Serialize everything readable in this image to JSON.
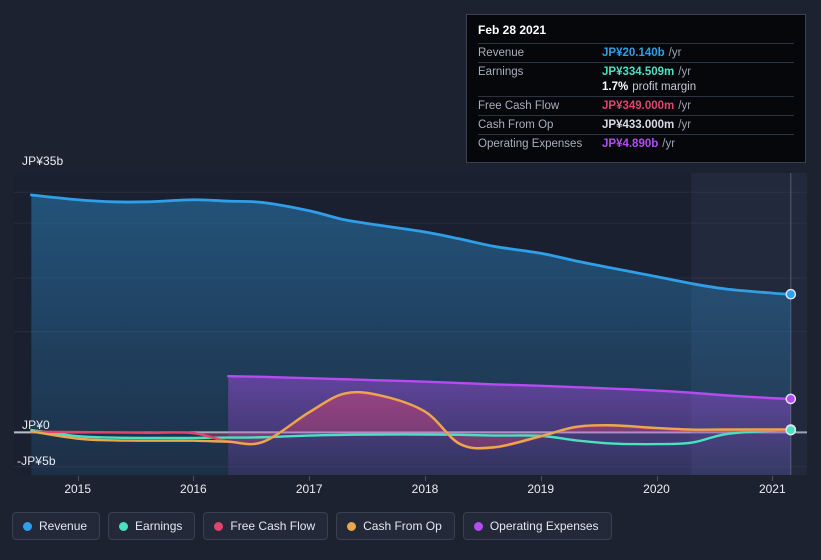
{
  "axis": {
    "y_labels": [
      {
        "text": "JP¥35b",
        "value": 35
      },
      {
        "text": "JP¥0",
        "value": 0
      },
      {
        "text": "-JP¥5b",
        "value": -5
      }
    ],
    "x_labels": [
      "2015",
      "2016",
      "2017",
      "2018",
      "2019",
      "2020",
      "2021"
    ]
  },
  "tooltip": {
    "date": "Feb 28 2021",
    "rows": [
      {
        "label": "Revenue",
        "value": "JP¥20.140b",
        "unit": "/yr",
        "color": "#2e9fe8"
      },
      {
        "label": "Earnings",
        "value": "JP¥334.509m",
        "unit": "/yr",
        "color": "#4ae0c0"
      },
      {
        "label": "",
        "value": "1.7%",
        "unit": "profit margin",
        "color": "#ffffff"
      },
      {
        "label": "Free Cash Flow",
        "value": "JP¥349.000m",
        "unit": "/yr",
        "color": "#e0446f"
      },
      {
        "label": "Cash From Op",
        "value": "JP¥433.000m",
        "unit": "/yr",
        "color": "#e8a councils"
      },
      {
        "label": "Operating Expenses",
        "value": "JP¥4.890b",
        "unit": "/yr",
        "color": "#b44cf0"
      }
    ]
  },
  "legend": [
    {
      "label": "Revenue",
      "color": "#2e9fe8",
      "icon": "series-dot-icon"
    },
    {
      "label": "Earnings",
      "color": "#4ae0c0",
      "icon": "series-dot-icon"
    },
    {
      "label": "Free Cash Flow",
      "color": "#e0446f",
      "icon": "series-dot-icon"
    },
    {
      "label": "Cash From Op",
      "color": "#e8a84c",
      "icon": "series-dot-icon"
    },
    {
      "label": "Operating Expenses",
      "color": "#b44cf0",
      "icon": "series-dot-icon"
    }
  ],
  "chart_data": {
    "type": "area",
    "title": "",
    "xlabel": "",
    "ylabel": "",
    "currency": "JPY",
    "ylim": [
      -6.2,
      37.8
    ],
    "xlim": [
      2014.45,
      2021.3
    ],
    "grid": true,
    "gridlines_y": [
      35,
      30.5,
      22.5,
      14.7,
      0,
      -5
    ],
    "legend_position": "bottom-left",
    "highlight_band": {
      "from": 2020.3,
      "to": 2021.3
    },
    "x": [
      2014.6,
      2015.0,
      2015.3,
      2015.6,
      2016.0,
      2016.3,
      2016.6,
      2017.0,
      2017.3,
      2017.6,
      2018.0,
      2018.3,
      2018.6,
      2019.0,
      2019.3,
      2019.6,
      2020.0,
      2020.3,
      2020.6,
      2021.0,
      2021.16
    ],
    "series": [
      {
        "name": "Revenue",
        "color": "#2e9fe8",
        "values": [
          34.6,
          33.9,
          33.6,
          33.6,
          33.9,
          33.7,
          33.5,
          32.3,
          31.0,
          30.2,
          29.2,
          28.2,
          27.1,
          26.1,
          25.0,
          24.0,
          22.7,
          21.7,
          20.9,
          20.3,
          20.14
        ],
        "last_value": 20.14,
        "last_label": "JP¥20.140b"
      },
      {
        "name": "Earnings",
        "color": "#4ae0c0",
        "values": [
          0.35,
          -0.55,
          -0.75,
          -0.8,
          -0.8,
          -0.75,
          -0.7,
          -0.45,
          -0.35,
          -0.3,
          -0.3,
          -0.35,
          -0.45,
          -0.5,
          -1.15,
          -1.6,
          -1.7,
          -1.5,
          -0.25,
          0.25,
          0.334509
        ],
        "last_value": 0.334509,
        "last_label": "JP¥334.509m"
      },
      {
        "name": "Free Cash Flow",
        "color": "#e0446f",
        "values": [
          0.1,
          0.05,
          0.0,
          -0.05,
          -0.1,
          -1.3,
          -1.35,
          2.9,
          5.6,
          5.4,
          3.0,
          -1.7,
          -2.2,
          -0.6,
          0.75,
          1.0,
          0.6,
          0.35,
          0.35,
          0.35,
          0.349
        ],
        "last_value": 0.349,
        "last_label": "JP¥349.000m"
      },
      {
        "name": "Cash From Op",
        "color": "#e8a84c",
        "values": [
          0.15,
          -0.9,
          -1.15,
          -1.2,
          -1.2,
          -1.35,
          -1.4,
          2.95,
          5.65,
          5.45,
          3.05,
          -1.65,
          -2.15,
          -0.55,
          0.8,
          1.05,
          0.65,
          0.42,
          0.43,
          0.43,
          0.433
        ],
        "last_value": 0.433,
        "last_label": "JP¥433.000m"
      },
      {
        "name": "Operating Expenses",
        "color": "#b44cf0",
        "values": [
          null,
          null,
          null,
          null,
          null,
          8.2,
          8.1,
          7.9,
          7.75,
          7.6,
          7.4,
          7.2,
          7.0,
          6.8,
          6.6,
          6.4,
          6.1,
          5.8,
          5.4,
          5.0,
          4.89
        ],
        "last_value": 4.89,
        "last_label": "JP¥4.890b"
      }
    ]
  }
}
